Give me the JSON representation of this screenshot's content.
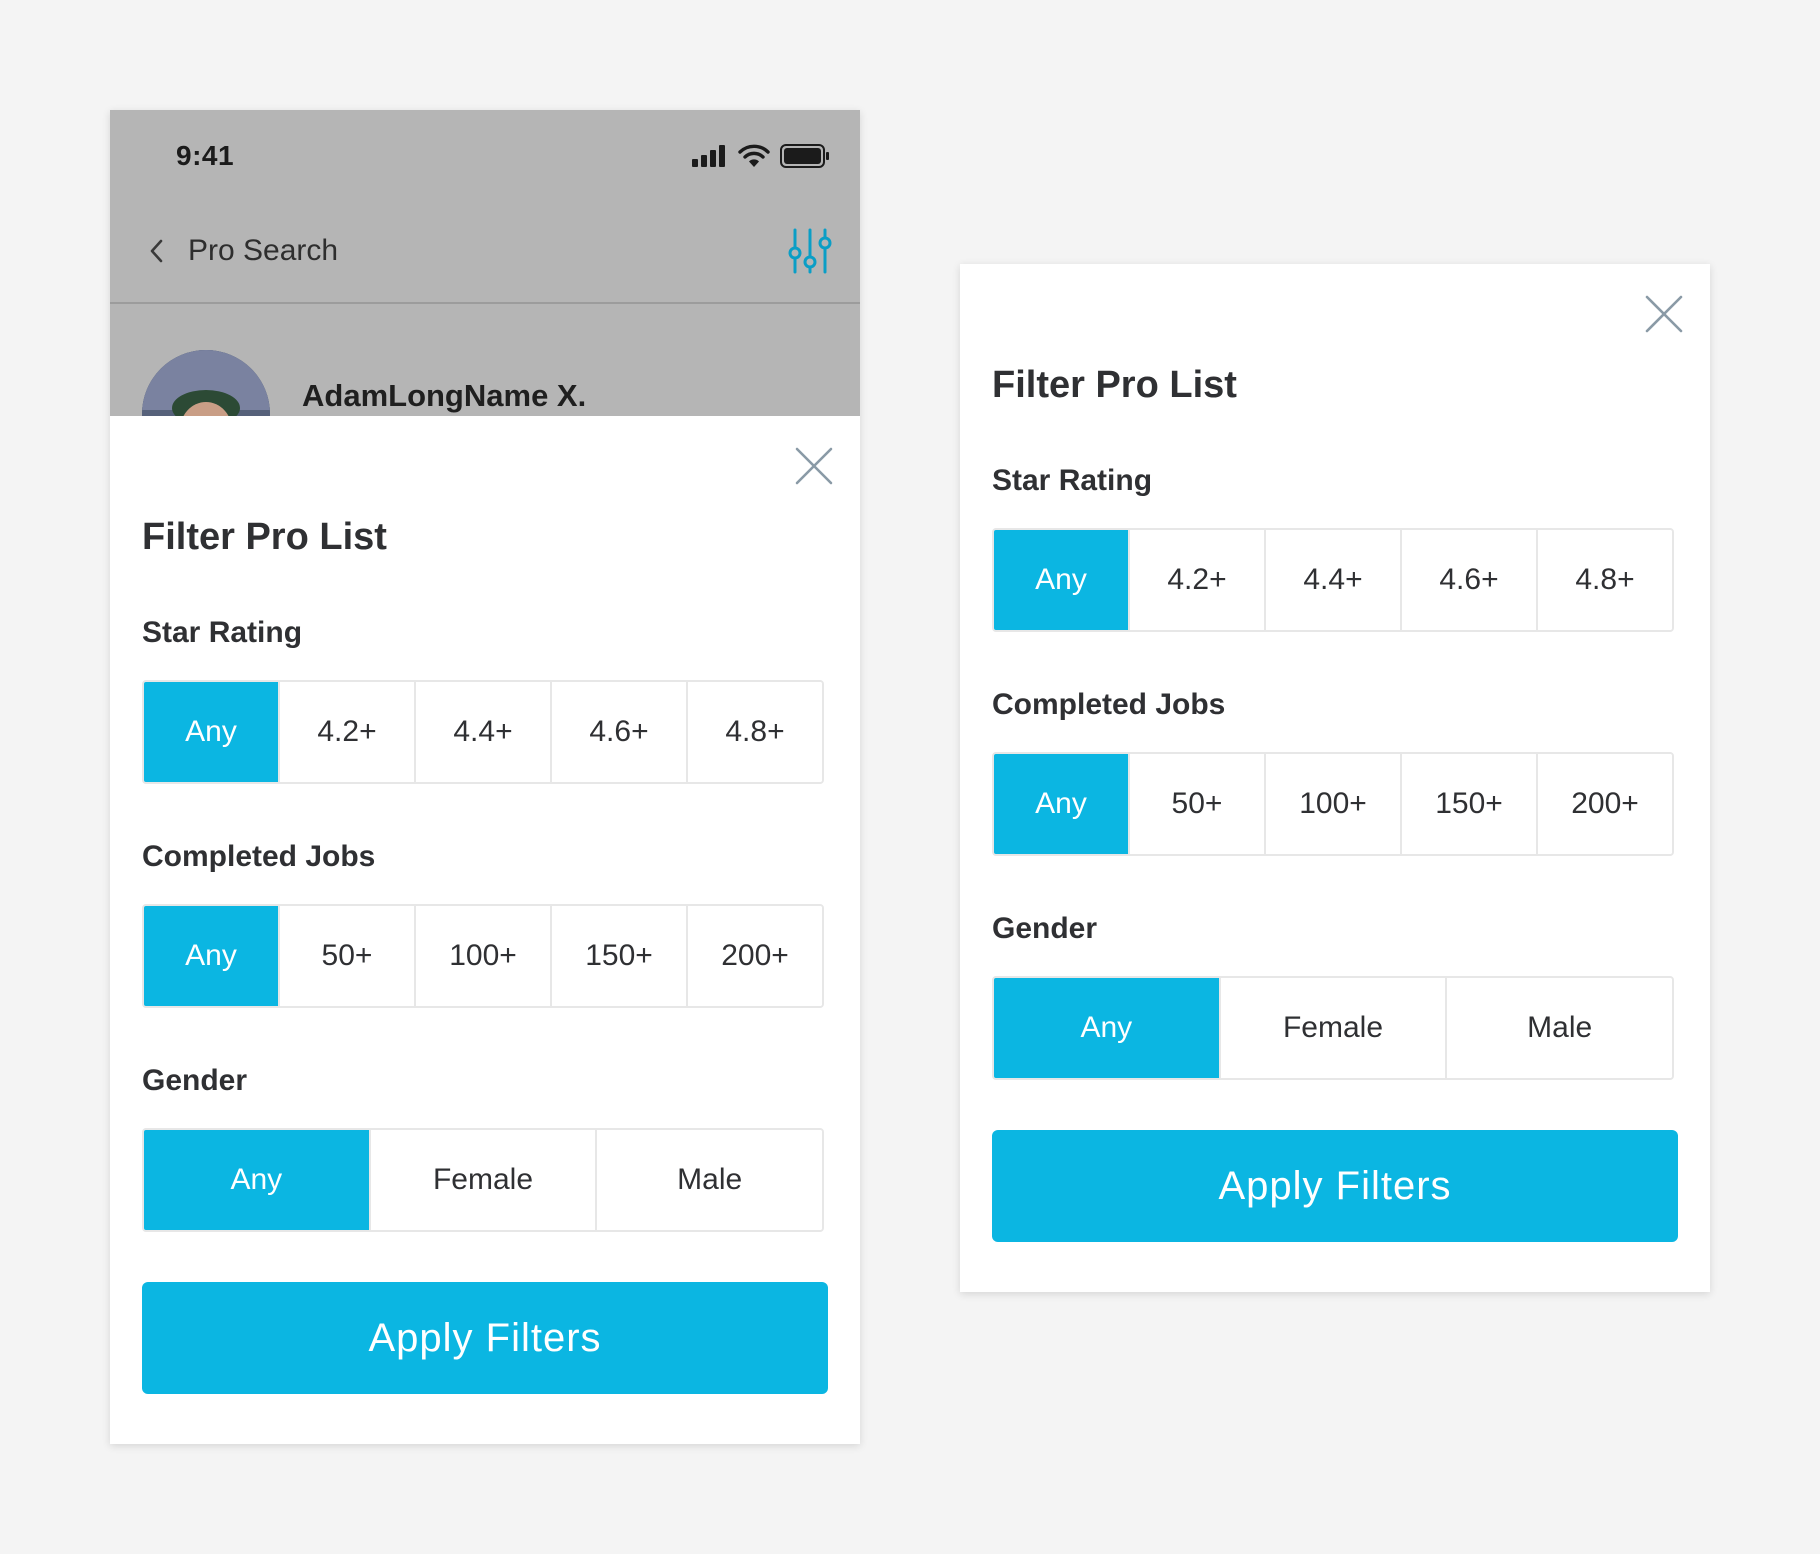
{
  "status_bar": {
    "time": "9:41"
  },
  "nav": {
    "title": "Pro Search"
  },
  "pro": {
    "name": "AdamLongName X."
  },
  "filter": {
    "title": "Filter Pro List",
    "star_rating": {
      "label": "Star Rating",
      "options": [
        "Any",
        "4.2+",
        "4.4+",
        "4.6+",
        "4.8+"
      ],
      "selected": 0
    },
    "completed_jobs": {
      "label": "Completed Jobs",
      "options": [
        "Any",
        "50+",
        "100+",
        "150+",
        "200+"
      ],
      "selected": 0
    },
    "gender": {
      "label": "Gender",
      "options": [
        "Any",
        "Female",
        "Male"
      ],
      "selected": 0
    },
    "apply_label": "Apply Filters"
  },
  "colors": {
    "accent": "#0bb6e2",
    "overlay_gray": "#b5b5b5",
    "page_background": "#f4f4f4",
    "border": "#e7e7e7",
    "text": "#2f3033"
  }
}
